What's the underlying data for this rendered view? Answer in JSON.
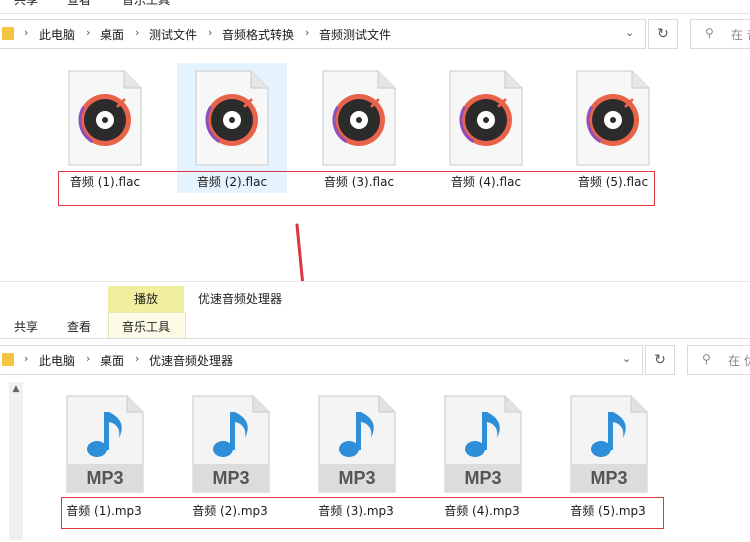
{
  "top_window": {
    "ribbon_tabs": [
      "共享",
      "查看",
      "音乐工具"
    ],
    "breadcrumb": [
      "此电脑",
      "桌面",
      "测试文件",
      "音频格式转换",
      "音频测试文件"
    ],
    "search_placeholder": "在 音",
    "files": [
      {
        "name": "音频 (1).flac",
        "selected": false
      },
      {
        "name": "音频 (2).flac",
        "selected": true
      },
      {
        "name": "音频 (3).flac",
        "selected": false
      },
      {
        "name": "音频 (4).flac",
        "selected": false
      },
      {
        "name": "音频 (5).flac",
        "selected": false
      }
    ]
  },
  "bottom_window": {
    "context_tab": "播放",
    "window_title": "优速音频处理器",
    "ribbon_tabs": [
      "共享",
      "查看",
      "音乐工具"
    ],
    "breadcrumb": [
      "此电脑",
      "桌面",
      "优速音频处理器"
    ],
    "search_placeholder": "在 优",
    "file_icon_text": "MP3",
    "files": [
      {
        "name": "音频 (1).mp3"
      },
      {
        "name": "音频 (2).mp3"
      },
      {
        "name": "音频 (3).mp3"
      },
      {
        "name": "音频 (4).mp3"
      },
      {
        "name": "音频 (5).mp3"
      }
    ]
  },
  "icons": {
    "flac": "music-disc-icon",
    "mp3": "music-note-icon",
    "folder": "folder-icon",
    "refresh": "refresh-icon",
    "search": "search-icon",
    "arrow": "red-arrow-annotation"
  },
  "colors": {
    "annotation_red": "#d9363e",
    "selection_blue": "#e5f3ff",
    "mp3_blue": "#2e8fd8",
    "disc_ring": "#e8634a",
    "context_tab_yellow": "#f0ef9e"
  }
}
